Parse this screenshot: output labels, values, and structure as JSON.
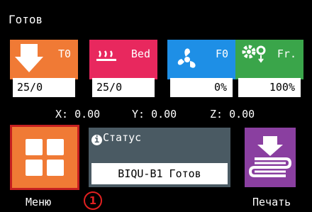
{
  "header": {
    "title": "Готов"
  },
  "tiles": [
    {
      "label": "T0",
      "value": "25/0",
      "color": "#f07a35",
      "icon": "nozzle-icon"
    },
    {
      "label": "Bed",
      "value": "25/0",
      "color": "#e8285e",
      "icon": "heated-bed-icon"
    },
    {
      "label": "F0",
      "value": "0%",
      "color": "#1e8fe6",
      "icon": "fan-icon"
    },
    {
      "label": "Fr.",
      "value": "100%",
      "color": "#3aa54a",
      "icon": "gears-flow-icon"
    }
  ],
  "coords": {
    "x": "X: 0.00",
    "y": "Y: 0.00",
    "z": "Z: 0.00"
  },
  "menu": {
    "label": "Меню",
    "icon": "grid-menu-icon",
    "color": "#f07a35",
    "border_color": "#c62020"
  },
  "status": {
    "heading": "Статус",
    "message": "BIQU-B1 Готов",
    "icon": "info-icon"
  },
  "print": {
    "label": "Печать",
    "icon": "print-layers-icon",
    "color": "#8a3fa0"
  },
  "annotation": {
    "number": "1"
  }
}
